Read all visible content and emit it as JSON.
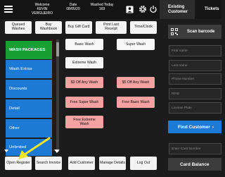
{
  "header": {
    "welcome_label": "Welcome",
    "welcome_name": "KEVIN VERGUEIRO",
    "date_label": "Date",
    "date_value": "08/05/20",
    "washed_label": "Washed Today",
    "washed_value": "169"
  },
  "toolbar": {
    "queued": "Queued Washes",
    "buy_washbook": "Buy Washbook",
    "buy_gift_card": "Buy Gift Card",
    "print_last_receipt": "Print Last Receipt",
    "time_clock": "Time/Clock"
  },
  "categories": [
    {
      "label": "WASH PACKAGES",
      "active": true
    },
    {
      "label": "Wash Extras",
      "active": false
    },
    {
      "label": "Discounts",
      "active": false
    },
    {
      "label": "Detail",
      "active": false
    },
    {
      "label": "Other",
      "active": false
    },
    {
      "label": "Unlimited",
      "active": false
    }
  ],
  "products": {
    "basic_wash": "Basic Wash",
    "super_wash": "Super Wash",
    "extreme_wash": "Extreme Wash",
    "off_3": "$3 Off Any Wash",
    "off_5": "$5 Off Any Wash",
    "free_super": "Free Super Wash",
    "free_basic": "Free Basic Wash",
    "free_extreme": "Free Extreme Wash"
  },
  "bottom": {
    "open_register": "Open Register",
    "search_invoice": "Search Invoice",
    "add_customer": "Add Customer",
    "manage_details": "Manage Details",
    "log_out": "Log Out"
  },
  "right_panel": {
    "tab_existing": "Existing Customer",
    "tab_tickets": "Tickets",
    "scan_barcode": "Scan barcode",
    "first_name_placeholder": "First name",
    "last_name_placeholder": "Last name",
    "phone_placeholder": "Phone Number",
    "rfid_placeholder": "RFID",
    "license_placeholder": "License Plate",
    "find_customer": "Find Customer",
    "find_chevron": "›",
    "card_number_placeholder": "Enter Card Number",
    "card_balance": "Card Balance"
  },
  "colors": {
    "blue": "#1c79d6",
    "green": "#16a034",
    "pink": "#f4a1a1",
    "arrow": "#f5e62a"
  }
}
